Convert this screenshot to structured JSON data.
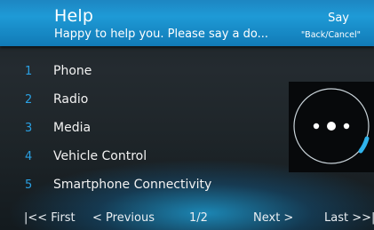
{
  "header": {
    "title": "Help",
    "subtitle": "Happy to help you. Please say a do...",
    "say_label": "Say",
    "say_hint": "\"Back/Cancel\""
  },
  "menu": {
    "items": [
      {
        "number": "1",
        "label": "Phone"
      },
      {
        "number": "2",
        "label": "Radio"
      },
      {
        "number": "3",
        "label": "Media"
      },
      {
        "number": "4",
        "label": "Vehicle Control"
      },
      {
        "number": "5",
        "label": "Smartphone Connectivity"
      }
    ]
  },
  "voice_indicator": {
    "icon": "listening-dots-icon",
    "accent": "#2fb3ec"
  },
  "footer": {
    "first": "|<< First",
    "previous": "< Previous",
    "page": "1/2",
    "next": "Next >",
    "last": "Last >>|"
  },
  "colors": {
    "header_blue": "#1e9ad6",
    "number_blue": "#2aa0e2",
    "text": "#f2f2f2"
  }
}
